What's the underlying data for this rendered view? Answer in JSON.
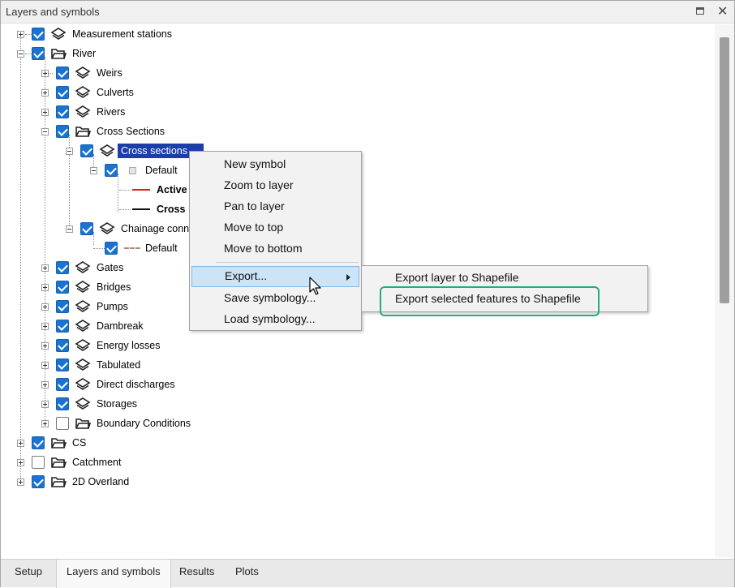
{
  "window": {
    "title": "Layers and symbols"
  },
  "tree": {
    "measurement_stations": "Measurement stations",
    "river": "River",
    "weirs": "Weirs",
    "culverts": "Culverts",
    "rivers": "Rivers",
    "cross_sections_group": "Cross Sections",
    "cross_sections_layer": "Cross sections",
    "default_1": "Default",
    "active": "Active",
    "cross": "Cross",
    "chainage": "Chainage conn",
    "default_2": "Default",
    "gates": "Gates",
    "bridges": "Bridges",
    "pumps": "Pumps",
    "dambreak": "Dambreak",
    "energy_losses": "Energy losses",
    "tabulated": "Tabulated",
    "direct_discharges": "Direct discharges",
    "storages": "Storages",
    "boundary_conditions": "Boundary Conditions",
    "cs": "CS",
    "catchment": "Catchment",
    "overland_2d": "2D Overland"
  },
  "context_menu": {
    "items": [
      "New symbol",
      "Zoom to layer",
      "Pan to layer",
      "Move to top",
      "Move to bottom",
      "Export...",
      "Save symbology...",
      "Load symbology..."
    ]
  },
  "export_submenu": {
    "items": [
      "Export layer to Shapefile",
      "Export selected features to Shapefile"
    ]
  },
  "tabs": [
    "Setup",
    "Layers and symbols",
    "Results",
    "Plots"
  ],
  "colors": {
    "checkbox": "#1a73d0",
    "selection": "#1c3ea8",
    "menu_hover": "#cce4f7",
    "highlight_ring": "#2aaa7a",
    "active_line": "#e02020"
  }
}
